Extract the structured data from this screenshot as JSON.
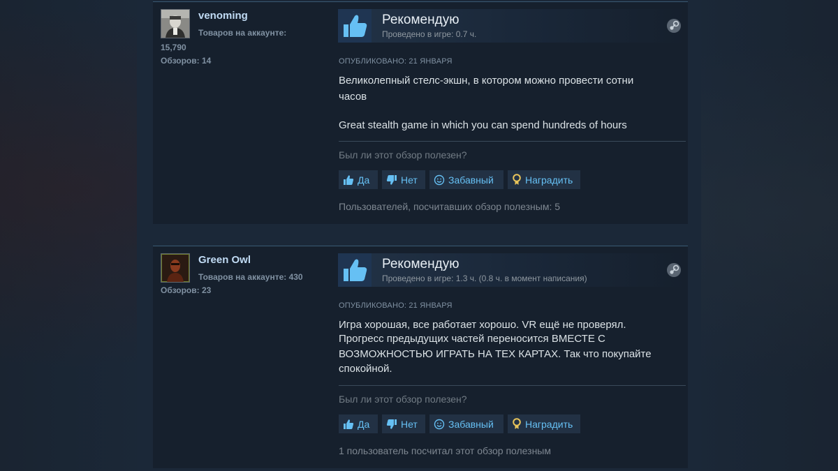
{
  "colors": {
    "background": "#1b2838",
    "card": "#16202d",
    "link_blue": "#66c0f4",
    "author_name": "#c1dbf4",
    "award_gold": "#e8c45a"
  },
  "reviews": [
    {
      "author": {
        "name": "venoming",
        "products_label": "Товаров на аккаунте:",
        "products_count": "15,790",
        "reviews_label": "Обзоров: 14"
      },
      "verdict": "Рекомендую",
      "hours": "Проведено в игре: 0.7 ч.",
      "posted": "ОПУБЛИКОВАНО: 21 ЯНВАРЯ",
      "body_lines": [
        "Великолепный стелс-экшн, в котором можно провести сотни",
        "часов",
        "Great stealth game in which you can spend hundreds of hours"
      ],
      "helpful_question": "Был ли этот обзор полезен?",
      "buttons": {
        "yes": "Да",
        "no": "Нет",
        "funny": "Забавный",
        "award": "Наградить"
      },
      "helpful_count": "Пользователей, посчитавших обзор полезным: 5",
      "icons": {
        "thumb": "thumbs-up-icon",
        "platform": "steam-icon"
      }
    },
    {
      "author": {
        "name": "Green Owl",
        "products_label": "Товаров на аккаунте: 430",
        "reviews_label": "Обзоров: 23"
      },
      "verdict": "Рекомендую",
      "hours": "Проведено в игре: 1.3 ч. (0.8 ч. в момент написания)",
      "posted": "ОПУБЛИКОВАНО: 21 ЯНВАРЯ",
      "body_lines": [
        "Игра хорошая, все работает хорошо. VR ещё не проверял.",
        "Прогресс предыдущих частей переносится ВМЕСТЕ С",
        "ВОЗМОЖНОСТЬЮ ИГРАТЬ НА ТЕХ КАРТАХ. Так что покупайте",
        "спокойной."
      ],
      "helpful_question": "Был ли этот обзор полезен?",
      "buttons": {
        "yes": "Да",
        "no": "Нет",
        "funny": "Забавный",
        "award": "Наградить"
      },
      "helpful_count": "1 пользователь посчитал этот обзор полезным",
      "icons": {
        "thumb": "thumbs-up-icon",
        "platform": "steam-icon"
      }
    }
  ]
}
